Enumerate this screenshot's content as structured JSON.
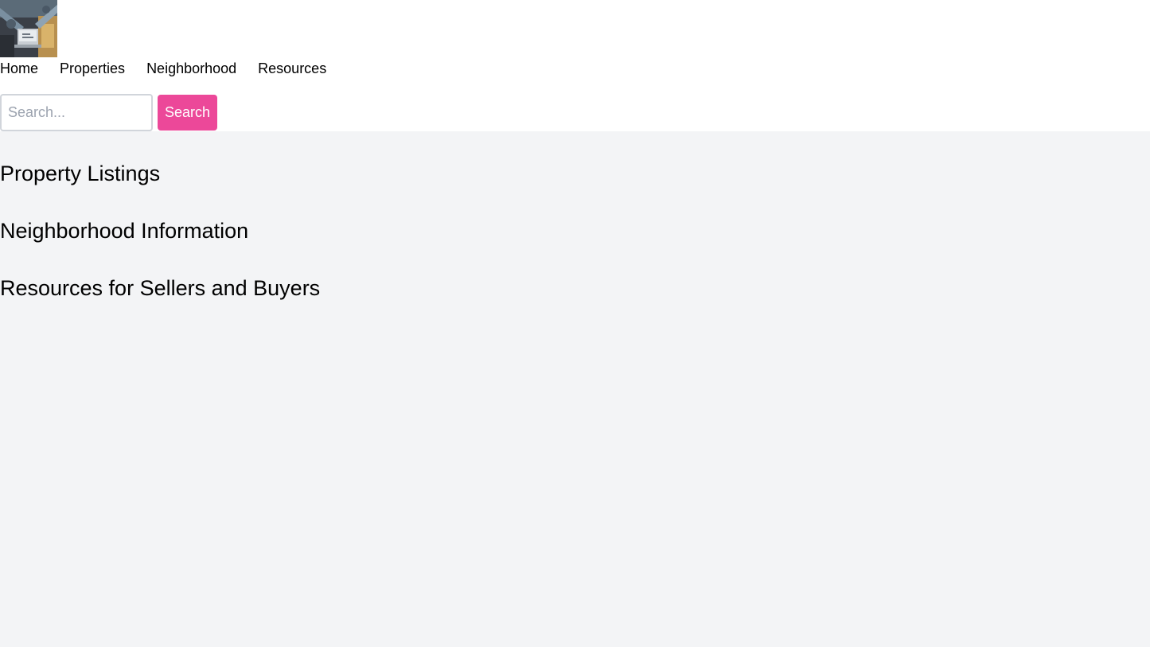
{
  "header": {
    "logo_icon": "workspace-photo-logo",
    "nav": {
      "items": [
        {
          "label": "Home"
        },
        {
          "label": "Properties"
        },
        {
          "label": "Neighborhood"
        },
        {
          "label": "Resources"
        }
      ]
    },
    "search": {
      "placeholder": "Search...",
      "value": "",
      "button_label": "Search"
    }
  },
  "main": {
    "sections": [
      {
        "title": "Property Listings"
      },
      {
        "title": "Neighborhood Information"
      },
      {
        "title": "Resources for Sellers and Buyers"
      }
    ]
  },
  "colors": {
    "accent": "#ec4899",
    "background": "#f3f4f6",
    "header_background": "#ffffff"
  }
}
